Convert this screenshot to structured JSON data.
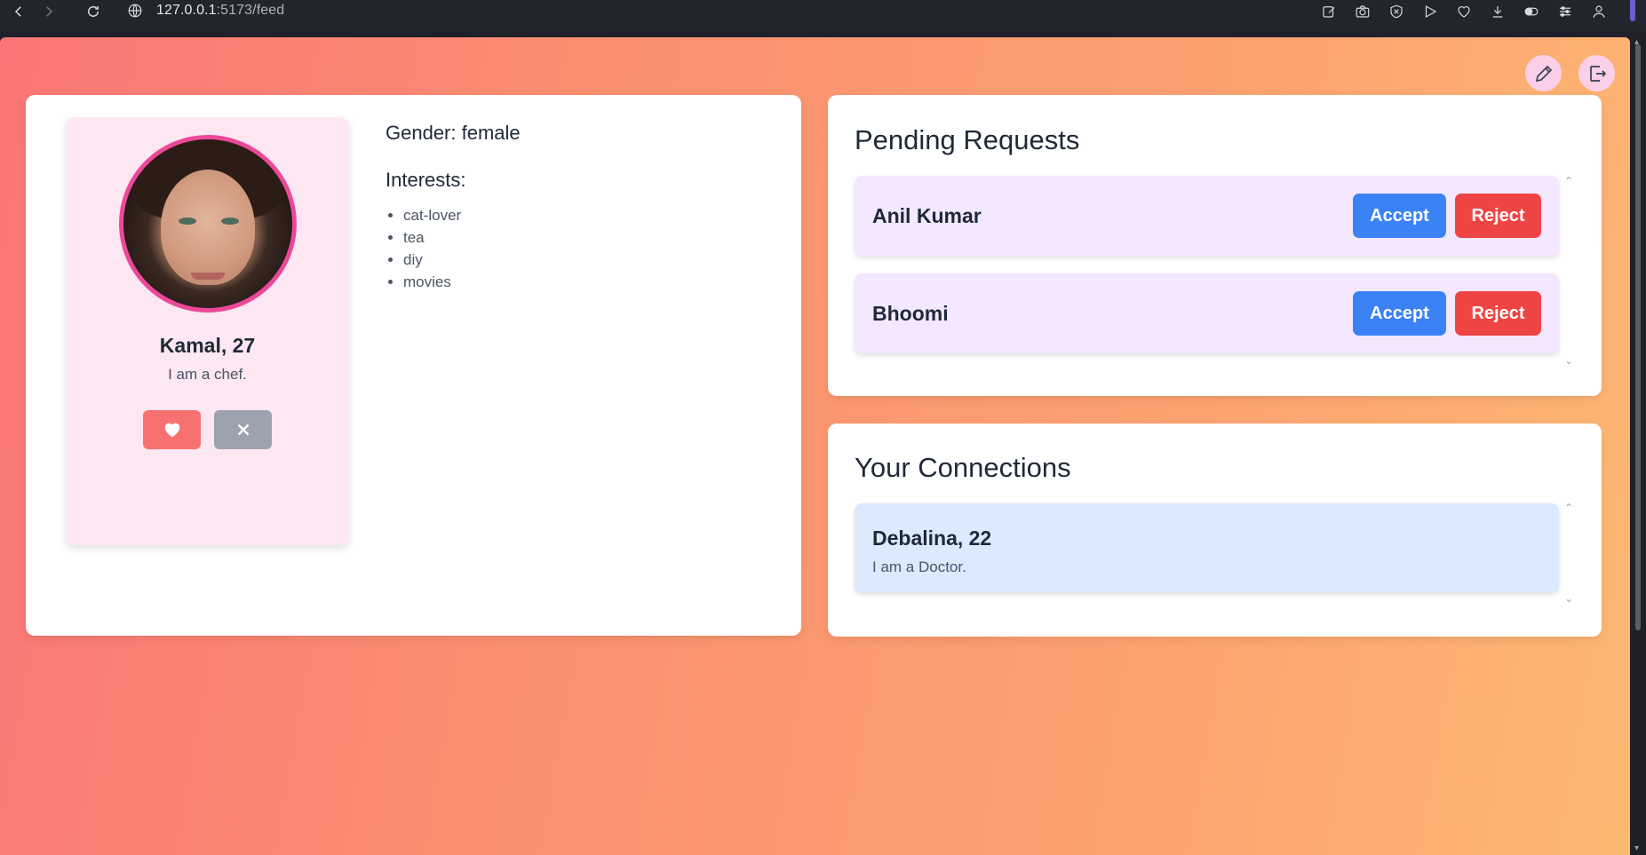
{
  "browser": {
    "url_host": "127.0.0.1",
    "url_rest": ":5173/feed"
  },
  "header": {
    "edit_icon": "pencil-icon",
    "logout_icon": "logout-icon"
  },
  "profile": {
    "name_age": "Kamal, 27",
    "bio": "I am a chef.",
    "gender": "Gender: female",
    "interests_title": "Interests:",
    "interests": [
      "cat-lover",
      "tea",
      "diy",
      "movies"
    ]
  },
  "requests": {
    "title": "Pending Requests",
    "accept_label": "Accept",
    "reject_label": "Reject",
    "items": [
      {
        "name": "Anil Kumar"
      },
      {
        "name": "Bhoomi"
      }
    ]
  },
  "connections": {
    "title": "Your Connections",
    "items": [
      {
        "name_age": "Debalina, 22",
        "bio": "I am a Doctor."
      }
    ]
  },
  "colors": {
    "accent_pink": "#ec4899",
    "accept": "#3b82f6",
    "reject": "#ef4444"
  }
}
